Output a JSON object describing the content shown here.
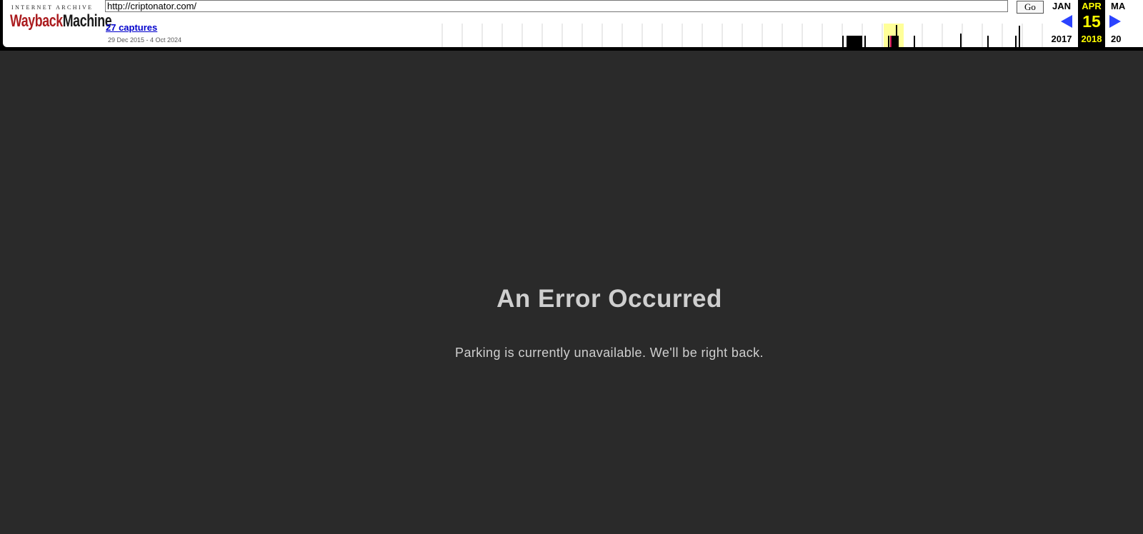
{
  "toolbar": {
    "logo": {
      "tagline": "INTERNET ARCHIVE",
      "word_red": "Wayback",
      "word_black": "Machine"
    },
    "url_value": "http://criptonator.com/",
    "go_label": "Go",
    "captures_label": "27 captures",
    "date_range": "29 Dec 2015 - 4 Oct 2024",
    "calendar": {
      "prev": {
        "month": "JAN",
        "year": "2017"
      },
      "current": {
        "month": "APR",
        "day": "15",
        "year": "2018"
      },
      "next": {
        "month": "MA",
        "year": "20"
      }
    },
    "colors": {
      "current_highlight": "#ffff00",
      "arrow": "#2b43ff",
      "logo_red": "#ab1c1f",
      "link": "#0000cc"
    }
  },
  "page": {
    "error_title": "An Error Occurred",
    "error_message": "Parking is currently unavailable. We'll be right back.",
    "background_color": "#2a2a2a"
  }
}
